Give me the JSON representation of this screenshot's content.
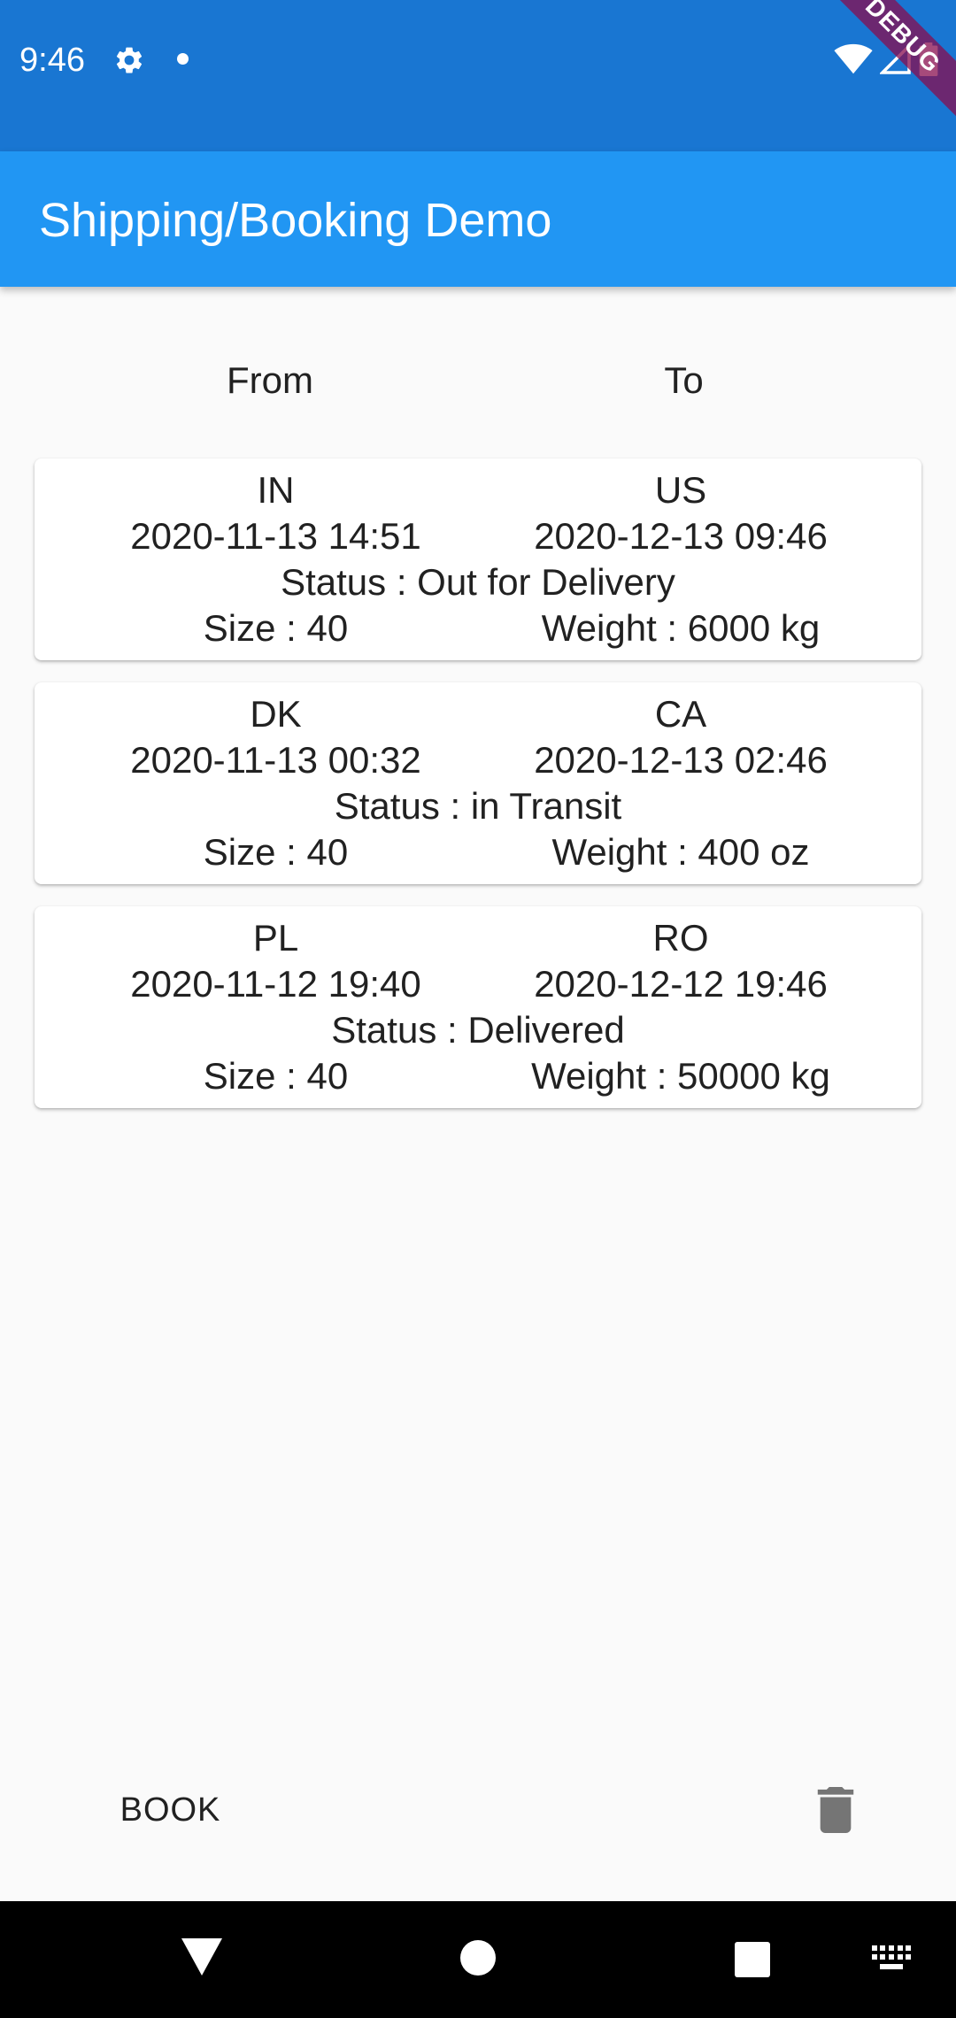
{
  "status_bar": {
    "time": "9:46",
    "icons": [
      "gear-icon",
      "notification-dot-icon",
      "wifi-icon",
      "signal-icon",
      "battery-icon"
    ],
    "debug_banner": "DEBUG"
  },
  "app_bar": {
    "title": "Shipping/Booking Demo",
    "color": "#2196f3",
    "status_color": "#1976d2"
  },
  "headers": {
    "from": "From",
    "to": "To"
  },
  "bookings": [
    {
      "from": "IN",
      "to": "US",
      "from_date": "2020-11-13 14:51",
      "to_date": "2020-12-13 09:46",
      "status": "Status : Out for Delivery",
      "size": "Size : 40",
      "weight": "Weight : 6000 kg"
    },
    {
      "from": "DK",
      "to": "CA",
      "from_date": "2020-11-13 00:32",
      "to_date": "2020-12-13 02:46",
      "status": "Status : in Transit",
      "size": "Size : 40",
      "weight": "Weight : 400 oz"
    },
    {
      "from": "PL",
      "to": "RO",
      "from_date": "2020-11-12 19:40",
      "to_date": "2020-12-12 19:46",
      "status": "Status : Delivered",
      "size": "Size : 40",
      "weight": "Weight : 50000 kg"
    }
  ],
  "actions": {
    "book_label": "BOOK",
    "delete_icon": "trash-icon"
  },
  "nav_bar": {
    "icons": [
      "back-icon",
      "home-icon",
      "recents-icon",
      "keyboard-icon"
    ]
  }
}
